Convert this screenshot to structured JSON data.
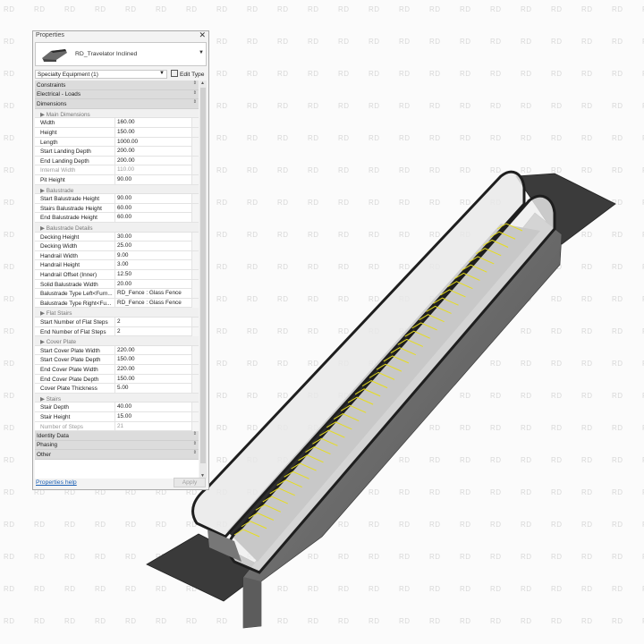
{
  "panel": {
    "title": "Properties",
    "close_glyph": "✕",
    "type_name": "RD_Travelator Inclined",
    "category_selector": "Specialty Equipment (1)",
    "edit_type_label": "Edit Type",
    "help_link": "Properties help",
    "apply_label": "Apply"
  },
  "rows": [
    {
      "kind": "group",
      "label": "Constraints"
    },
    {
      "kind": "group",
      "label": "Electrical - Loads"
    },
    {
      "kind": "group",
      "label": "Dimensions"
    },
    {
      "kind": "sub",
      "label": "▶ Main Dimensions"
    },
    {
      "kind": "param",
      "name": "Width",
      "value": "160.00"
    },
    {
      "kind": "param",
      "name": "Height",
      "value": "150.00"
    },
    {
      "kind": "param",
      "name": "Length",
      "value": "1000.00"
    },
    {
      "kind": "param",
      "name": "Start Landing Depth",
      "value": "200.00"
    },
    {
      "kind": "param",
      "name": "End Landing Depth",
      "value": "200.00"
    },
    {
      "kind": "param",
      "name": "Internal Width",
      "value": "110.00",
      "readonly": true
    },
    {
      "kind": "param",
      "name": "Pit Height",
      "value": "90.00"
    },
    {
      "kind": "sub",
      "label": "▶ Balustrade"
    },
    {
      "kind": "param",
      "name": "Start Balustrade Height",
      "value": "90.00"
    },
    {
      "kind": "param",
      "name": "Stairs Balustrade Height",
      "value": "60.00"
    },
    {
      "kind": "param",
      "name": "End Balustrade Height",
      "value": "60.00"
    },
    {
      "kind": "sub",
      "label": "▶ Balustrade Details"
    },
    {
      "kind": "param",
      "name": "Decking Height",
      "value": "30.00"
    },
    {
      "kind": "param",
      "name": "Decking Width",
      "value": "25.00"
    },
    {
      "kind": "param",
      "name": "Handrail Width",
      "value": "9.00"
    },
    {
      "kind": "param",
      "name": "Handrail Height",
      "value": "3.00"
    },
    {
      "kind": "param",
      "name": "Handrail Offset (Inner)",
      "value": "12.50"
    },
    {
      "kind": "param",
      "name": "Solid Balustrade Width",
      "value": "20.00"
    },
    {
      "kind": "param",
      "name": "Balustrade Type Left<Furn...",
      "value": "RD_Fence : Glass Fence"
    },
    {
      "kind": "param",
      "name": "Balustrade Type Right<Fu...",
      "value": "RD_Fence : Glass Fence"
    },
    {
      "kind": "sub",
      "label": "▶ Flat Stairs"
    },
    {
      "kind": "param",
      "name": "Start Number of Flat Steps",
      "value": "2"
    },
    {
      "kind": "param",
      "name": "End Number of Flat Steps",
      "value": "2"
    },
    {
      "kind": "sub",
      "label": "▶ Cover Plate"
    },
    {
      "kind": "param",
      "name": "Start Cover Plate Width",
      "value": "220.00"
    },
    {
      "kind": "param",
      "name": "Start Cover Plate Depth",
      "value": "150.00"
    },
    {
      "kind": "param",
      "name": "End Cover Plate Width",
      "value": "220.00"
    },
    {
      "kind": "param",
      "name": "End Cover Plate Depth",
      "value": "150.00"
    },
    {
      "kind": "param",
      "name": "Cover Plate Thickness",
      "value": "5.00"
    },
    {
      "kind": "sub",
      "label": "▶ Stairs"
    },
    {
      "kind": "param",
      "name": "Stair Depth",
      "value": "40.00"
    },
    {
      "kind": "param",
      "name": "Stair Height",
      "value": "15.00"
    },
    {
      "kind": "param",
      "name": "Number of Steps",
      "value": "21",
      "readonly": true
    },
    {
      "kind": "group",
      "label": "Identity Data"
    },
    {
      "kind": "group",
      "label": "Phasing"
    },
    {
      "kind": "group",
      "label": "Other"
    }
  ],
  "watermark_text": "RD",
  "colors": {
    "accent_yellow": "#e7dd1e",
    "dark_surface": "#3d3d3d",
    "link_blue": "#1a5fb4"
  }
}
